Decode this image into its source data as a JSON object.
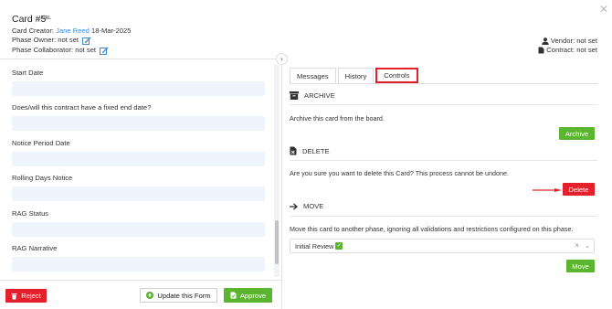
{
  "header": {
    "title": "Card #5",
    "url_badge": "URL",
    "creator_label": "Card Creator:",
    "creator_name": "Jane Reed",
    "creator_date": "18-Mar-2025",
    "phase_owner": "Phase Owner: not set",
    "phase_collaborator": "Phase Collaborator: not set",
    "vendor": "Vendor: not set",
    "contract": "Contract: not set"
  },
  "form": {
    "fields": [
      "Start Date",
      "Does/will this contract have a fixed end date?",
      "Notice Period Date",
      "Rolling Days Notice",
      "RAG Status",
      "RAG Narrative"
    ]
  },
  "footer": {
    "reject": "Reject",
    "update": "Update this Form",
    "approve": "Approve"
  },
  "tabs": [
    "Messages",
    "History",
    "Controls"
  ],
  "active_tab": "Controls",
  "archive": {
    "heading": "ARCHIVE",
    "description": "Archive this card from the board.",
    "button": "Archive"
  },
  "delete": {
    "heading": "DELETE",
    "description": "Are you sure you want to delete this Card? This process cannot be undone.",
    "button": "Delete"
  },
  "move": {
    "heading": "MOVE",
    "description": "Move this card to another phase, ignoring all validations and restrictions configured on this phase.",
    "selected_phase": "Initial Review",
    "button": "Move"
  },
  "colors": {
    "accent_red": "#e3202b",
    "accent_green": "#5cb531",
    "link_blue": "#3a8bd3"
  }
}
